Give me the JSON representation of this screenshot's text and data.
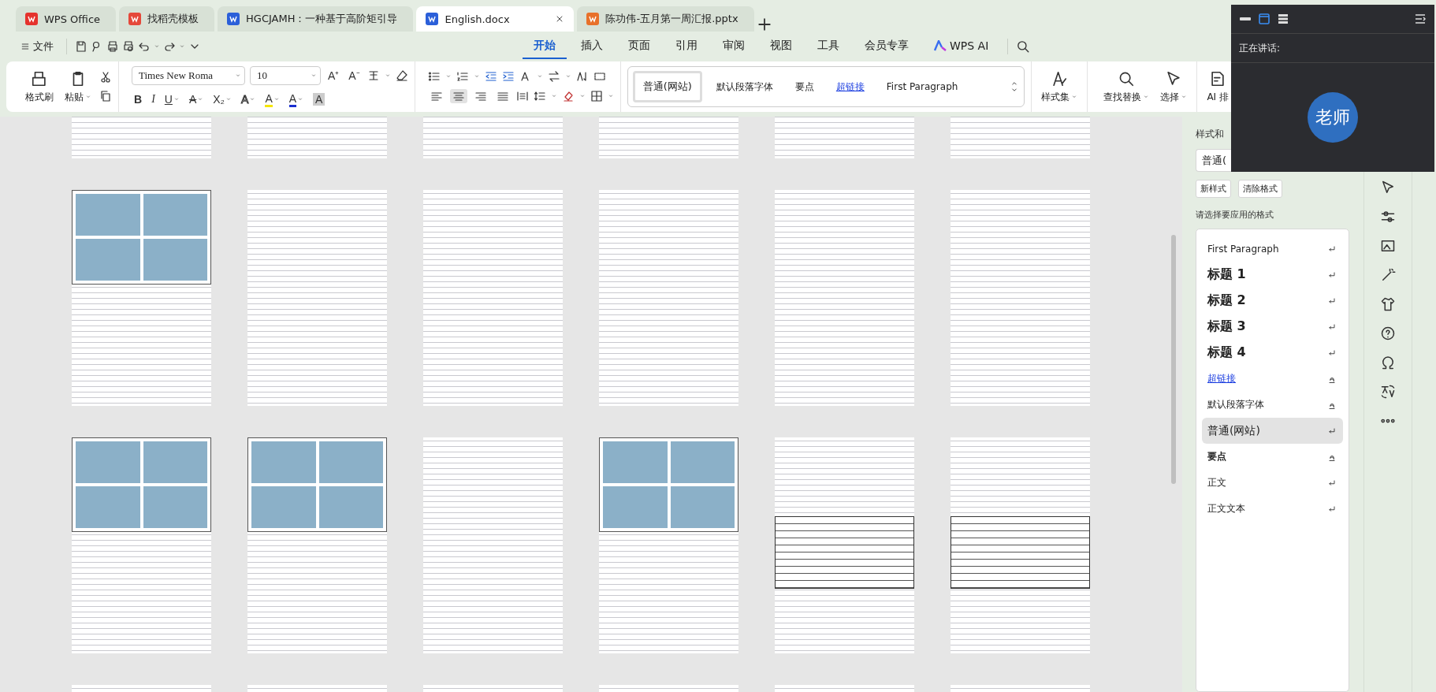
{
  "tabs": [
    {
      "label": "WPS Office",
      "kind": "wps",
      "selected": false
    },
    {
      "label": "找稻壳模板",
      "kind": "docer",
      "selected": false
    },
    {
      "label": "HGCJAMH：一种基于高阶矩引导",
      "kind": "word",
      "selected": false
    },
    {
      "label": "English.docx",
      "kind": "word",
      "selected": true
    },
    {
      "label": "陈功伟-五月第一周汇报.pptx",
      "kind": "ppt",
      "selected": false
    }
  ],
  "menu": {
    "file": "文件",
    "tabs": [
      {
        "label": "开始",
        "kind": "text",
        "selected": true
      },
      {
        "label": "插入",
        "kind": "text",
        "selected": false
      },
      {
        "label": "页面",
        "kind": "text",
        "selected": false
      },
      {
        "label": "引用",
        "kind": "text",
        "selected": false
      },
      {
        "label": "审阅",
        "kind": "text",
        "selected": false
      },
      {
        "label": "视图",
        "kind": "text",
        "selected": false
      },
      {
        "label": "工具",
        "kind": "text",
        "selected": false
      },
      {
        "label": "会员专享",
        "kind": "text",
        "selected": false
      },
      {
        "label": "WPS AI",
        "kind": "ai",
        "selected": false
      }
    ]
  },
  "ribbon": {
    "format_painter": "格式刷",
    "paste": "粘贴",
    "font_name": "Times New Roma",
    "font_size": "10",
    "grow": "A⁺",
    "shrink": "A⁻",
    "format_buttons": [
      {
        "kind": "bold",
        "glyph": "B"
      },
      {
        "kind": "italic",
        "glyph": "I"
      },
      {
        "kind": "underline",
        "glyph": "U"
      },
      {
        "kind": "strike",
        "glyph": "A"
      },
      {
        "kind": "subscript",
        "glyph": "X₂"
      },
      {
        "kind": "effect",
        "glyph": "A"
      },
      {
        "kind": "highlight",
        "glyph": "A"
      },
      {
        "kind": "color",
        "glyph": "A"
      },
      {
        "kind": "shading",
        "glyph": "A"
      }
    ],
    "align_buttons": [
      {
        "kind": "left",
        "selected": false
      },
      {
        "kind": "center",
        "selected": true
      },
      {
        "kind": "right",
        "selected": false
      },
      {
        "kind": "justify",
        "selected": false
      }
    ],
    "styles_gallery": [
      {
        "label": "普通(网站)",
        "kind": "plain",
        "selected": true
      },
      {
        "label": "默认段落字体",
        "kind": "plain",
        "selected": false
      },
      {
        "label": "要点",
        "kind": "emphasis",
        "selected": false
      },
      {
        "label": "超链接",
        "kind": "link",
        "selected": false
      },
      {
        "label": "First Paragraph",
        "kind": "plain",
        "selected": false
      }
    ],
    "style_set": "样式集",
    "find_replace": "查找替换",
    "select": "选择",
    "ai_layout": "AI 排"
  },
  "pages": [
    {
      "kind": "text"
    },
    {
      "kind": "text"
    },
    {
      "kind": "text"
    },
    {
      "kind": "text"
    },
    {
      "kind": "text"
    },
    {
      "kind": "text"
    },
    {
      "kind": "figure"
    },
    {
      "kind": "text"
    },
    {
      "kind": "text"
    },
    {
      "kind": "text"
    },
    {
      "kind": "text"
    },
    {
      "kind": "text"
    },
    {
      "kind": "figure"
    },
    {
      "kind": "figure"
    },
    {
      "kind": "text"
    },
    {
      "kind": "figure"
    },
    {
      "kind": "table"
    },
    {
      "kind": "table"
    },
    {
      "kind": "text"
    },
    {
      "kind": "text"
    },
    {
      "kind": "text"
    },
    {
      "kind": "text"
    },
    {
      "kind": "text"
    },
    {
      "kind": "text"
    }
  ],
  "styles_panel": {
    "title": "样式和",
    "current_style": "普通(",
    "new_style": "新样式",
    "clear_format": "清除格式",
    "prompt": "请选择要应用的格式",
    "items": [
      {
        "label": "First Paragraph",
        "kind": "paragraph",
        "selected": false
      },
      {
        "label": "标题 1",
        "kind": "heading",
        "selected": false
      },
      {
        "label": "标题 2",
        "kind": "heading",
        "selected": false
      },
      {
        "label": "标题 3",
        "kind": "heading",
        "selected": false
      },
      {
        "label": "标题 4",
        "kind": "heading",
        "selected": false
      },
      {
        "label": "超链接",
        "kind": "link",
        "selected": false
      },
      {
        "label": "默认段落字体",
        "kind": "character",
        "selected": false
      },
      {
        "label": "普通(网站)",
        "kind": "paragraph",
        "selected": true
      },
      {
        "label": "要点",
        "kind": "emphasis",
        "selected": false
      },
      {
        "label": "正文",
        "kind": "paragraph",
        "selected": false
      },
      {
        "label": "正文文本",
        "kind": "paragraph",
        "selected": false
      }
    ]
  },
  "meeting": {
    "speaking_label": "正在讲话:",
    "speaker": "老师",
    "views": [
      {
        "kind": "bar",
        "selected": false
      },
      {
        "kind": "window",
        "selected": true
      },
      {
        "kind": "stack",
        "selected": false
      }
    ]
  }
}
